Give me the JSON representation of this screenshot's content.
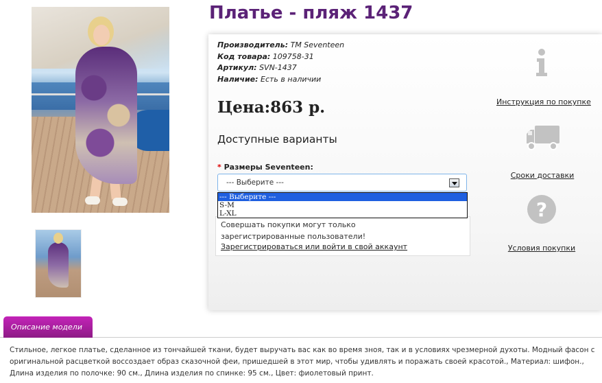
{
  "product": {
    "title": "Платье - пляж 1437",
    "manufacturer_label": "Производитель:",
    "manufacturer": "TM Seventeen",
    "code_label": "Код товара:",
    "code": "109758-31",
    "article_label": "Артикул:",
    "article": "SVN-1437",
    "availability_label": "Наличие:",
    "availability": "Есть в наличии",
    "price": "Цена:863 р."
  },
  "options": {
    "heading": "Доступные варианты",
    "required_mark": "*",
    "size_label": "Размеры Seventeen:",
    "select_value": "--- Выберите ---",
    "dropdown_items": [
      "--- Выберите ---",
      "S-M",
      "L-XL"
    ]
  },
  "notice": {
    "text": "Совершать покупки могут только зарегистрированные пользователи!",
    "link": "Зарегистрироваться или войти в свой аккаунт"
  },
  "side_links": {
    "instructions": "Инструкция по покупке",
    "delivery": "Сроки доставки",
    "terms": "Условия покупки"
  },
  "tabs": {
    "description_tab": "Описание модели"
  },
  "description": "Стильное, легкое платье, сделанное из тончайшей ткани, будет выручать вас как во время зноя, так и в условиях чрезмерной духоты. Модный фасон с оригинальной расцветкой воссоздает образ сказочной феи, пришедшей в этот мир, чтобы удивлять и поражать своей красотой., Материал: шифон., Длина изделия по полочке: 90 см., Длина изделия по спинке: 95 см., Цвет: фиолетовый принт.",
  "colors": {
    "title": "#5b2277",
    "tab": "#a51f9c",
    "dropdown_selected": "#1e5fe0",
    "icon_gray": "#c2c2c2"
  },
  "icons": [
    "info-icon",
    "truck-icon",
    "question-icon"
  ]
}
